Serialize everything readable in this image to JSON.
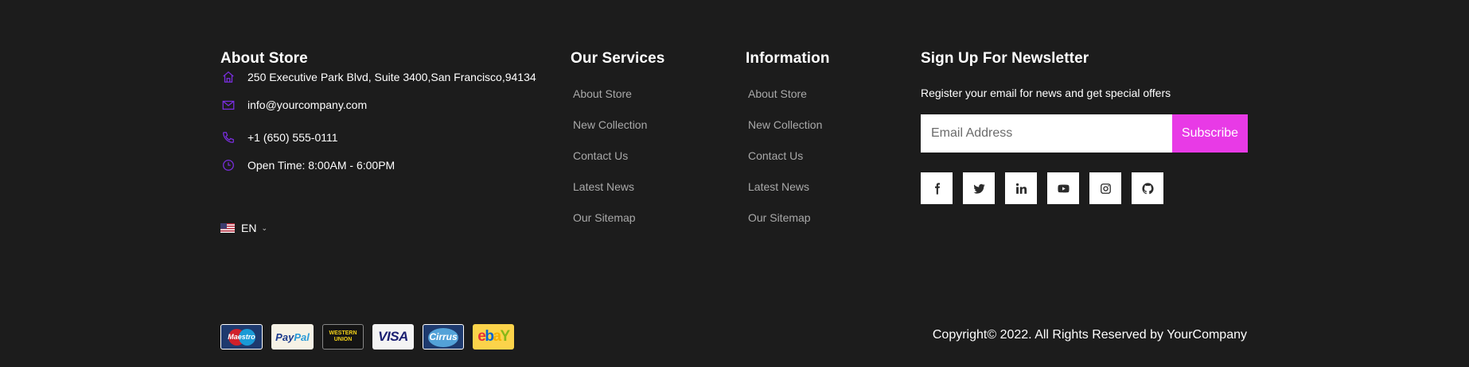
{
  "about": {
    "heading": "About Store",
    "address": "250 Executive Park Blvd, Suite 3400,San Francisco,94134",
    "email": "info@yourcompany.com",
    "phone": "+1 (650) 555-0111",
    "hours": "Open Time: 8:00AM - 6:00PM",
    "language": "EN"
  },
  "services": {
    "heading": "Our Services",
    "links": [
      "About Store",
      "New Collection",
      "Contact Us",
      "Latest News",
      "Our Sitemap"
    ]
  },
  "information": {
    "heading": "Information",
    "links": [
      "About Store",
      "New Collection",
      "Contact Us",
      "Latest News",
      "Our Sitemap"
    ]
  },
  "newsletter": {
    "heading": "Sign Up For Newsletter",
    "text": "Register your email for news and get special offers",
    "placeholder": "Email Address",
    "button": "Subscribe",
    "social": [
      "facebook-icon",
      "twitter-icon",
      "linkedin-icon",
      "youtube-icon",
      "instagram-icon",
      "github-icon"
    ]
  },
  "payments": {
    "maestro": "Maestro",
    "paypal_pay": "Pay",
    "paypal_pal": "Pal",
    "western_union_line1": "WESTERN",
    "western_union_line2": "UNION",
    "visa": "VISA",
    "cirrus": "Cirrus",
    "ebay_e": "e",
    "ebay_b": "b",
    "ebay_a": "a",
    "ebay_y": "Y"
  },
  "colors": {
    "background": "#1c1c1c",
    "accent": "#e83ae6",
    "icon_purple": "#7a2ee0",
    "link_gray": "#a9a9a9"
  },
  "copyright": "Copyright© 2022. All Rights Reserved by YourCompany"
}
